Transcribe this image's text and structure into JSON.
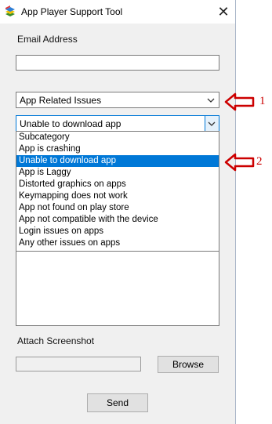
{
  "window": {
    "title": "App Player Support Tool"
  },
  "email": {
    "label": "Email Address",
    "value": ""
  },
  "category": {
    "selected": "App Related Issues"
  },
  "subcategory": {
    "selected": "Unable to download app",
    "options": [
      "Subcategory",
      "App is crashing",
      "Unable to download app",
      "App is Laggy",
      "Distorted graphics on apps",
      "Keymapping does not work",
      "App not found on play store",
      "App not compatible with the device",
      "Login issues on apps",
      "Any other issues on apps"
    ],
    "highlighted_index": 2
  },
  "attach": {
    "label": "Attach Screenshot",
    "path": "",
    "browse_label": "Browse"
  },
  "send_label": "Send",
  "annotations": {
    "one": "1",
    "two": "2",
    "color": "#cc0000"
  }
}
